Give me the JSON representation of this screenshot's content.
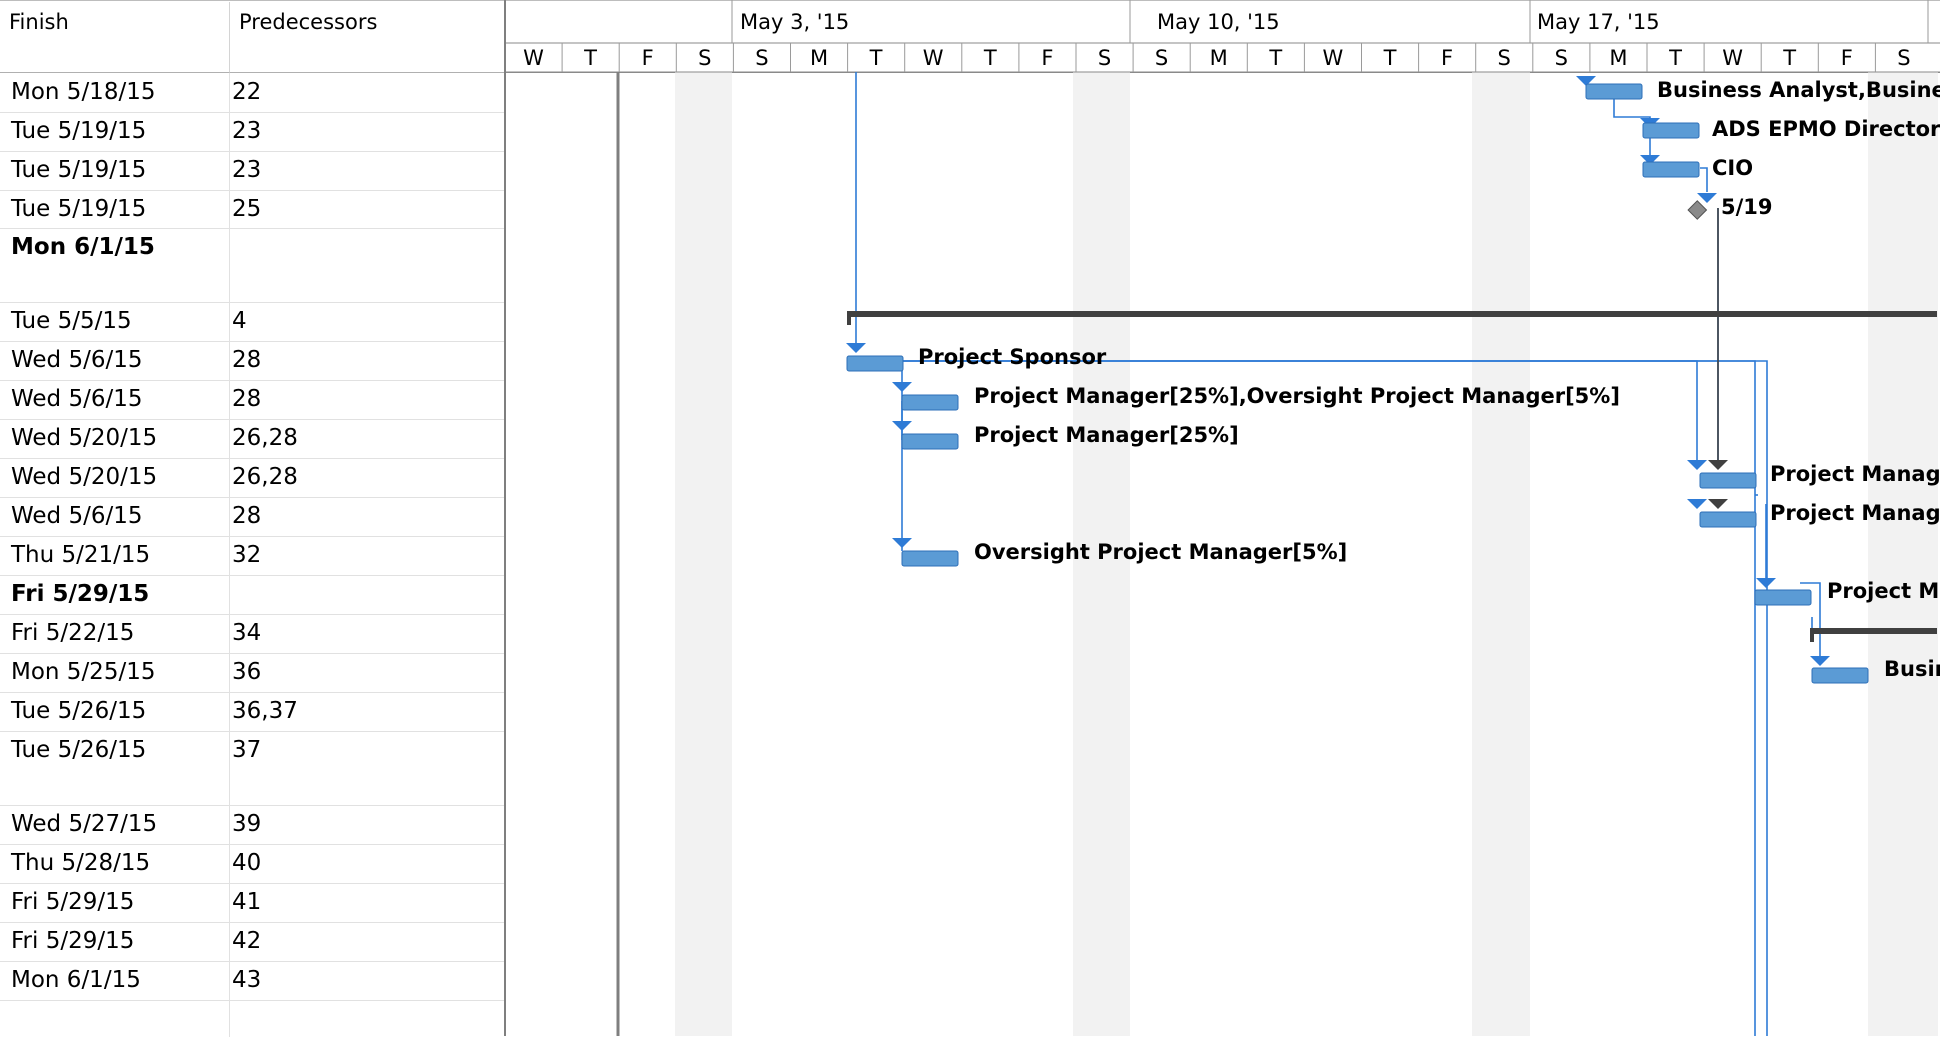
{
  "columns": {
    "finish": "Finish",
    "predecessors": "Predecessors"
  },
  "rows": [
    {
      "finish": "Mon 5/18/15",
      "pred": "22",
      "bold": false
    },
    {
      "finish": "Tue 5/19/15",
      "pred": "23",
      "bold": false
    },
    {
      "finish": "Tue 5/19/15",
      "pred": "23",
      "bold": false
    },
    {
      "finish": "Tue 5/19/15",
      "pred": "25",
      "bold": false
    },
    {
      "finish": "Mon 6/1/15",
      "pred": "",
      "bold": true
    },
    {
      "finish": "Tue 5/5/15",
      "pred": "4",
      "bold": false
    },
    {
      "finish": "Wed 5/6/15",
      "pred": "28",
      "bold": false
    },
    {
      "finish": "Wed 5/6/15",
      "pred": "28",
      "bold": false
    },
    {
      "finish": "Wed 5/20/15",
      "pred": "26,28",
      "bold": false
    },
    {
      "finish": "Wed 5/20/15",
      "pred": "26,28",
      "bold": false
    },
    {
      "finish": "Wed 5/6/15",
      "pred": "28",
      "bold": false
    },
    {
      "finish": "Thu 5/21/15",
      "pred": "32",
      "bold": false
    },
    {
      "finish": "Fri 5/29/15",
      "pred": "",
      "bold": true
    },
    {
      "finish": "Fri 5/22/15",
      "pred": "34",
      "bold": false
    },
    {
      "finish": "Mon 5/25/15",
      "pred": "36",
      "bold": false
    },
    {
      "finish": "Tue 5/26/15",
      "pred": "36,37",
      "bold": false
    },
    {
      "finish": "Tue 5/26/15",
      "pred": "37",
      "bold": false
    },
    {
      "finish": "Wed 5/27/15",
      "pred": "39",
      "bold": false
    },
    {
      "finish": "Thu 5/28/15",
      "pred": "40",
      "bold": false
    },
    {
      "finish": "Fri 5/29/15",
      "pred": "41",
      "bold": false
    },
    {
      "finish": "Fri 5/29/15",
      "pred": "42",
      "bold": false
    },
    {
      "finish": "Mon 6/1/15",
      "pred": "43",
      "bold": false
    }
  ],
  "timescale": {
    "weeks": [
      "May 3, '15",
      "May 10, '15",
      "May 17, '15"
    ],
    "days": [
      "W",
      "T",
      "F",
      "S",
      "S",
      "M",
      "T",
      "W",
      "T",
      "F",
      "S",
      "S",
      "M",
      "T",
      "W",
      "T",
      "F",
      "S",
      "S",
      "M",
      "T",
      "W",
      "T",
      "F",
      "S"
    ]
  },
  "labels": {
    "r0": "Business Analyst,Business",
    "r1": "ADS EPMO Director",
    "r2": "CIO",
    "r3": "5/19",
    "r5": "Project Sponsor",
    "r6": "Project Manager[25%],Oversight Project Manager[5%]",
    "r7": "Project Manager[25%]",
    "r8": "Project Manage",
    "r9": "Project Manage",
    "r10": "Oversight Project Manager[5%]",
    "r11": "Project Ma",
    "r13": "Busin"
  },
  "colors": {
    "task_bar": "#5b9bd5",
    "link_line": "#2e7bd6",
    "summary_bar": "#404040",
    "weekend_shade": "#f2f2f2"
  }
}
